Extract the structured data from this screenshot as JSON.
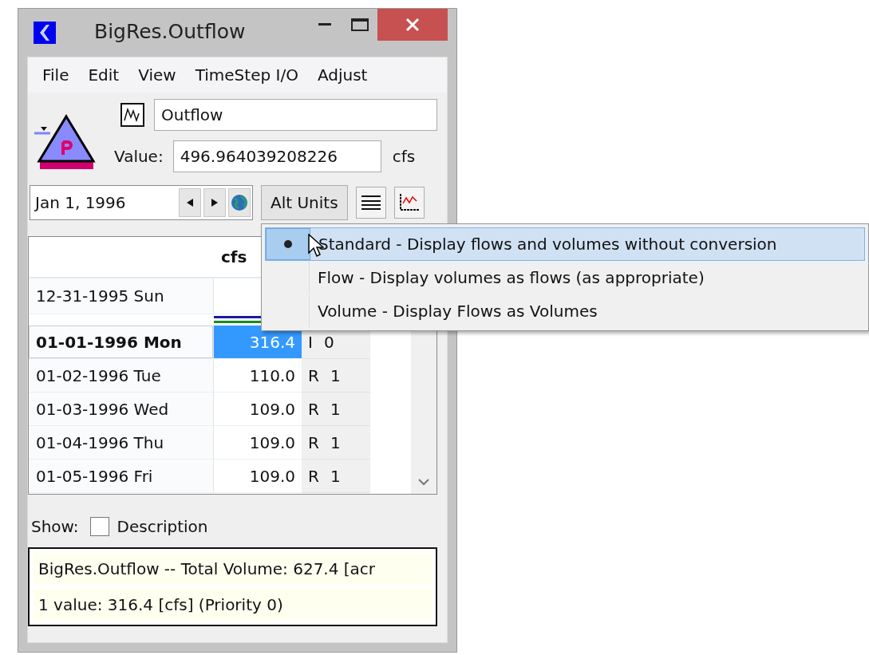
{
  "window": {
    "title": "BigRes.Outflow"
  },
  "menubar": [
    "File",
    "Edit",
    "View",
    "TimeStep I/O",
    "Adjust"
  ],
  "slot": {
    "name": "Outflow",
    "value_label": "Value:",
    "value": "496.964039208226",
    "units": "cfs"
  },
  "date_bar": {
    "date": "Jan 1, 1996",
    "alt_units_button": "Alt Units"
  },
  "table": {
    "header": "cfs",
    "rows": [
      {
        "date": "12-31-1995 Sun",
        "current": false,
        "selected": false
      },
      {
        "date": "01-01-1996 Mon",
        "value": "316.4",
        "flag": "I",
        "priority": "0",
        "current": true,
        "selected": true
      },
      {
        "date": "01-02-1996 Tue",
        "value": "110.0",
        "flag": "R",
        "priority": "1",
        "current": false,
        "selected": false
      },
      {
        "date": "01-03-1996 Wed",
        "value": "109.0",
        "flag": "R",
        "priority": "1",
        "current": false,
        "selected": false
      },
      {
        "date": "01-04-1996 Thu",
        "value": "109.0",
        "flag": "R",
        "priority": "1",
        "current": false,
        "selected": false
      },
      {
        "date": "01-05-1996 Fri",
        "value": "109.0",
        "flag": "R",
        "priority": "1",
        "current": false,
        "selected": false
      }
    ]
  },
  "alt_units_menu": [
    {
      "label": "Standard - Display flows and volumes without conversion",
      "selected": true
    },
    {
      "label": "Flow - Display volumes as flows (as appropriate)",
      "selected": false
    },
    {
      "label": "Volume - Display Flows as Volumes",
      "selected": false
    }
  ],
  "show": {
    "label": "Show:",
    "options": [
      {
        "label": "Description",
        "checked": false
      }
    ]
  },
  "status": [
    "BigRes.Outflow -- Total Volume: 627.4 [acr",
    "1 value:  316.4 [cfs]  (Priority 0)"
  ]
}
